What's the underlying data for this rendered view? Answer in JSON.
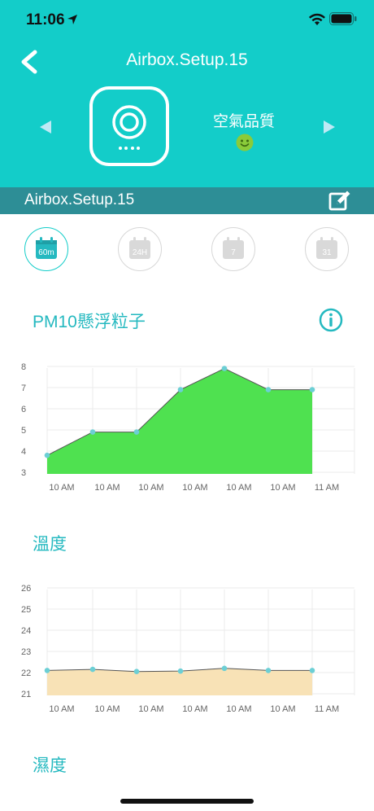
{
  "status": {
    "time": "11:06"
  },
  "header": {
    "title": "Airbox.Setup.15",
    "air_quality_label": "空氣品質"
  },
  "device_bar": {
    "name": "Airbox.Setup.15"
  },
  "periods": [
    {
      "label": "60m",
      "active": true
    },
    {
      "label": "24H",
      "active": false
    },
    {
      "label": "7",
      "active": false
    },
    {
      "label": "31",
      "active": false
    }
  ],
  "sections": {
    "pm10": "PM10懸浮粒子",
    "temperature": "溫度",
    "humidity": "濕度"
  },
  "colors": {
    "brand": "#13cdc9",
    "bar": "#2d8e96",
    "pm10_fill": "#4fe150",
    "temp_fill": "#f8e2b6",
    "point": "#6ccfd5"
  },
  "chart_data": [
    {
      "type": "area",
      "x": [
        "10 AM",
        "10 AM",
        "10 AM",
        "10 AM",
        "10 AM",
        "10 AM",
        "11 AM"
      ],
      "values": [
        3.8,
        4.9,
        4.9,
        6.9,
        7.9,
        6.9,
        6.9
      ],
      "ylim": [
        3,
        8
      ],
      "yticks": [
        3,
        4,
        5,
        6,
        7,
        8
      ],
      "title": "PM10懸浮粒子",
      "grid": true
    },
    {
      "type": "area",
      "x": [
        "10 AM",
        "10 AM",
        "10 AM",
        "10 AM",
        "10 AM",
        "10 AM",
        "11 AM"
      ],
      "values": [
        22.1,
        22.15,
        22.05,
        22.07,
        22.2,
        22.1,
        22.1
      ],
      "ylim": [
        21,
        26
      ],
      "yticks": [
        21,
        22,
        23,
        24,
        25,
        26
      ],
      "title": "溫度",
      "grid": true
    }
  ]
}
